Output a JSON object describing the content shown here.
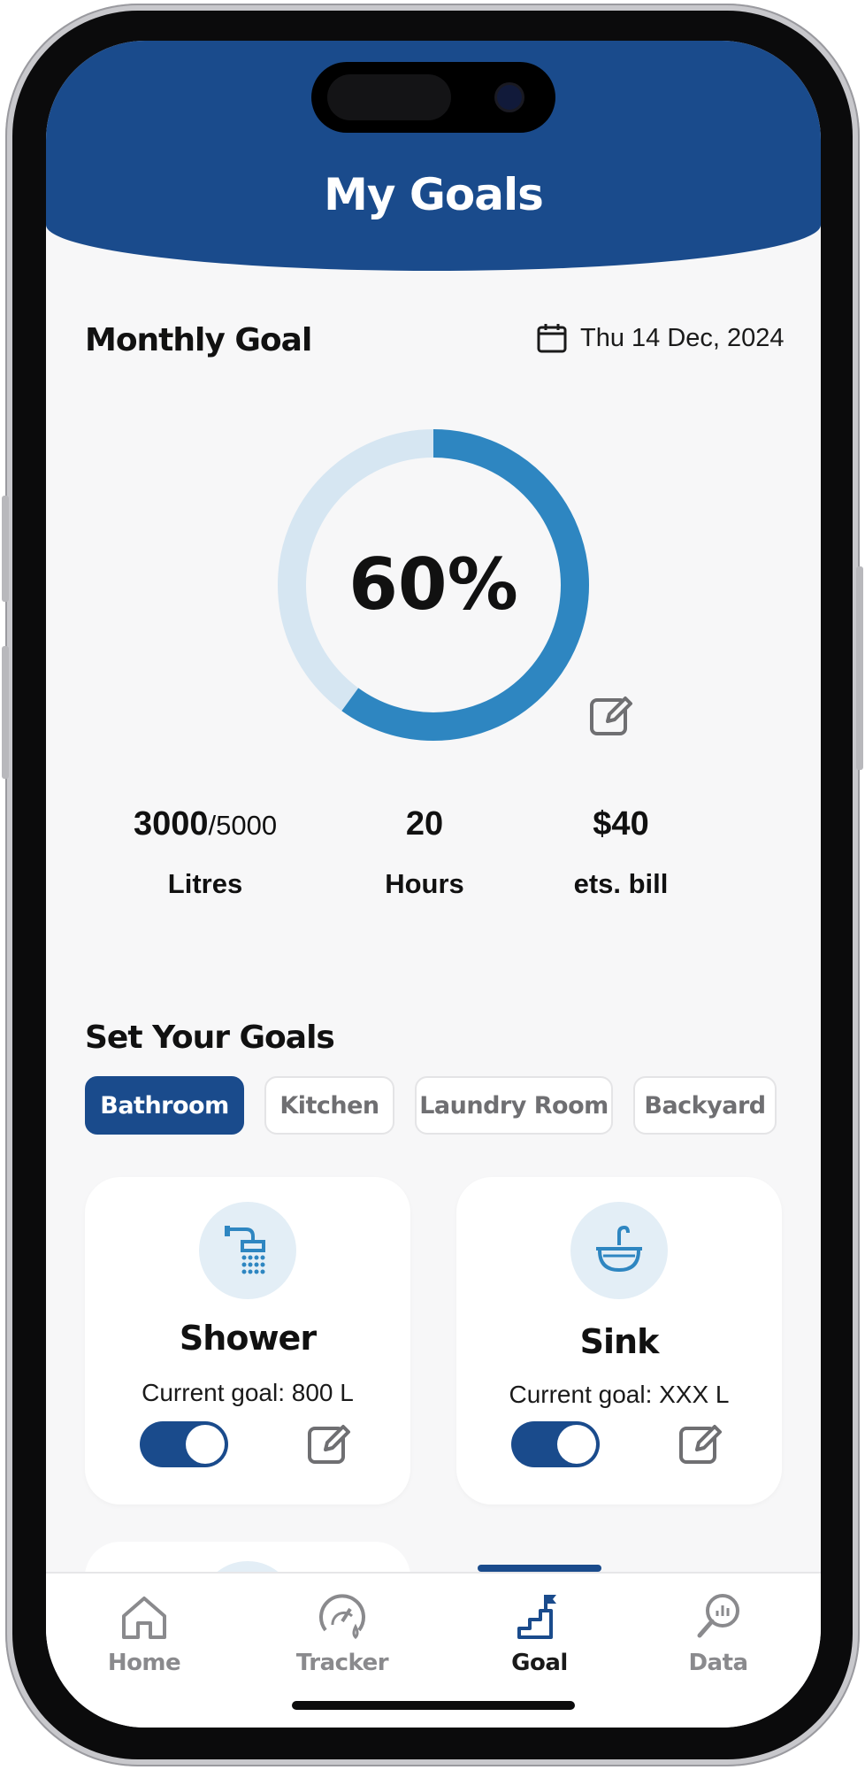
{
  "header": {
    "title": "My Goals"
  },
  "monthly_goal": {
    "title": "Monthly Goal",
    "date": "Thu 14 Dec, 2024",
    "progress_label": "60%",
    "progress_fraction": 0.6,
    "stats": [
      {
        "value": "3000",
        "value_sub": "/5000",
        "label": "Litres"
      },
      {
        "value": "20",
        "value_sub": "",
        "label": "Hours"
      },
      {
        "value": "$40",
        "value_sub": "",
        "label": "ets. bill"
      }
    ]
  },
  "set_goals": {
    "title": "Set Your Goals",
    "tabs": [
      {
        "label": "Bathroom",
        "active": true
      },
      {
        "label": "Kitchen",
        "active": false
      },
      {
        "label": "Laundry Room",
        "active": false
      },
      {
        "label": "Backyard",
        "active": false
      }
    ],
    "cards": [
      {
        "name": "Shower",
        "goal": "Current goal: 800 L",
        "icon": "shower-icon",
        "enabled": true
      },
      {
        "name": "Sink",
        "goal": "Current goal: XXX L",
        "icon": "sink-icon",
        "enabled": true
      }
    ]
  },
  "nav": {
    "items": [
      {
        "label": "Home",
        "icon": "home-icon",
        "active": false
      },
      {
        "label": "Tracker",
        "icon": "gauge-icon",
        "active": false
      },
      {
        "label": "Goal",
        "icon": "goal-stairs-flag-icon",
        "active": true
      },
      {
        "label": "Data",
        "icon": "data-search-chart-icon",
        "active": false
      }
    ]
  },
  "colors": {
    "primary": "#1a4b8c",
    "accent": "#2e86c1",
    "ring_track": "#d6e6f2",
    "icon_bg": "#e3eef6",
    "background": "#f7f7f8"
  }
}
